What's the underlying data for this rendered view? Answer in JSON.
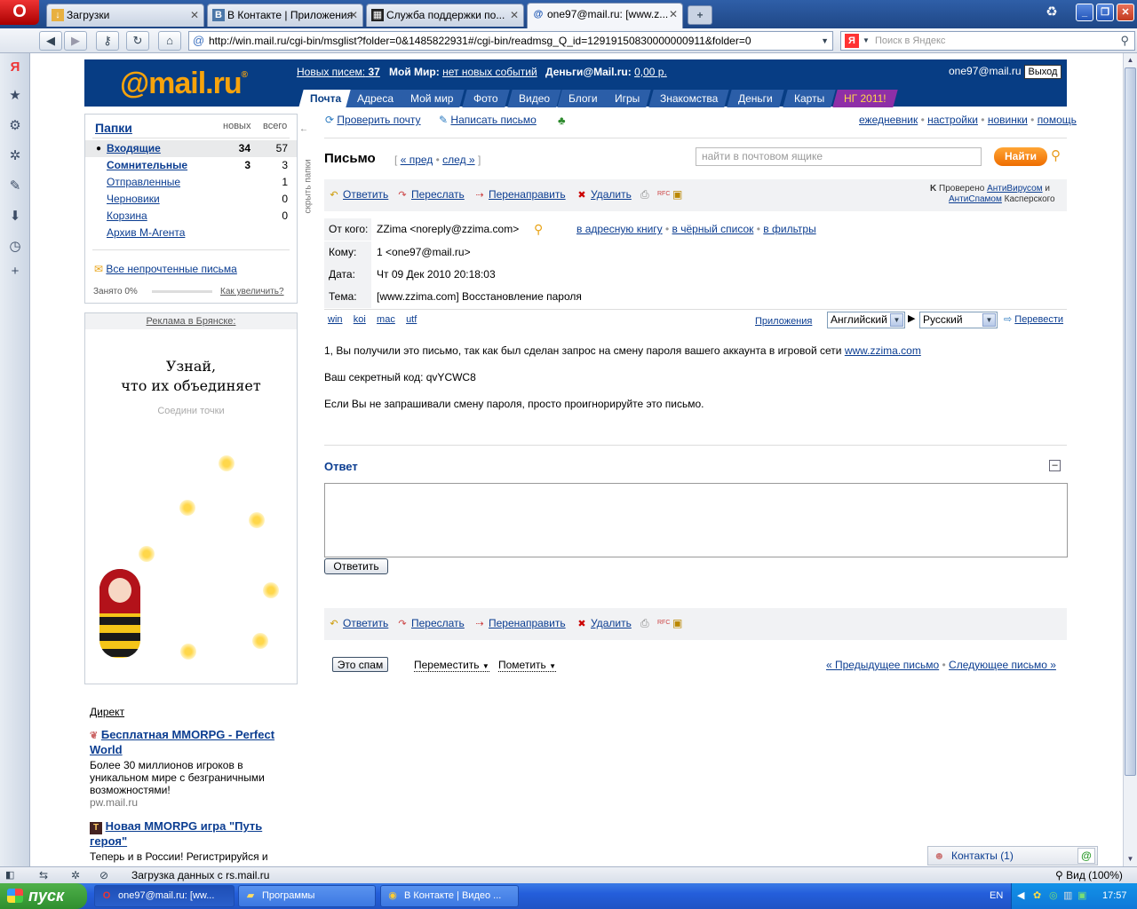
{
  "browser": {
    "tabs": [
      {
        "label": "Загрузки",
        "icon": "download-icon"
      },
      {
        "label": "В Контакте | Приложения",
        "icon": "vk-icon"
      },
      {
        "label": "Служба поддержки по...",
        "icon": "support-icon"
      },
      {
        "label": "one97@mail.ru: [www.z...",
        "icon": "mail-icon"
      }
    ],
    "url": "http://win.mail.ru/cgi-bin/msglist?folder=0&1485822931#/cgi-bin/readmsg_Q_id=12919150830000000911&folder=0",
    "search_placeholder": "Поиск в Яндекс",
    "yandex_letter": "Я",
    "status_text": "Загрузка данных с rs.mail.ru",
    "zoom": "Вид (100%)"
  },
  "header": {
    "logo": "@mail.ru",
    "new_mail_label": "Новых писем:",
    "new_mail_count": "37",
    "myworld_label": "Мой Мир:",
    "myworld_value": "нет новых событий",
    "money_label": "Деньги@Mail.ru:",
    "money_value": "0,00 р.",
    "user": "one97@mail.ru",
    "logout": "Выход",
    "nav": [
      "Почта",
      "Адреса",
      "Мой мир",
      "Фото",
      "Видео",
      "Блоги",
      "Игры",
      "Знакомства",
      "Деньги",
      "Карты",
      "НГ 2011!"
    ]
  },
  "folders": {
    "title": "Папки",
    "col_new": "новых",
    "col_all": "всего",
    "hide": "скрыть папки",
    "items": [
      {
        "name": "Входящие",
        "new": "34",
        "all": "57"
      },
      {
        "name": "Сомнительные",
        "new": "3",
        "all": "3"
      },
      {
        "name": "Отправленные",
        "new": "",
        "all": "1"
      },
      {
        "name": "Черновики",
        "new": "",
        "all": "0"
      },
      {
        "name": "Корзина",
        "new": "",
        "all": "0"
      },
      {
        "name": "Архив М-Агента",
        "new": "",
        "all": ""
      }
    ],
    "unread_link": "Все непрочтенные письма",
    "usage": "Занято 0%",
    "increase": "Как увеличить?"
  },
  "ad": {
    "header": "Реклама в Брянске:",
    "line1": "Узнай,",
    "line2": "что их объединяет",
    "sub": "Соедини точки"
  },
  "direct": {
    "title": "Директ",
    "items": [
      {
        "title": "Бесплатная MMORPG - Perfect World",
        "text": "Более 30 миллионов игроков в уникальном мире с безграничными возможностями!",
        "url": "pw.mail.ru"
      },
      {
        "title": "Новая MMORPG игра \"Путь героя\"",
        "text": "Теперь и в России! Регистрируйся и",
        "url": ""
      }
    ]
  },
  "actions": {
    "check": "Проверить почту",
    "compose": "Написать письмо",
    "right_links": [
      "ежедневник",
      "настройки",
      "новинки",
      "помощь"
    ]
  },
  "letter": {
    "title": "Письмо",
    "prev": "« пред",
    "next": "след »",
    "search_placeholder": "найти в почтовом ящике",
    "find": "Найти",
    "toolbar": {
      "reply": "Ответить",
      "forward": "Переслать",
      "redirect": "Перенаправить",
      "delete": "Удалить",
      "rfc": "RFC"
    },
    "checked_1": "Проверено",
    "checked_av": "АнтиВирусом",
    "checked_and": "и",
    "checked_as": "АнтиСпамом",
    "checked_2": "Касперского",
    "from_label": "От кого:",
    "from": "ZZima <noreply@zzima.com>",
    "from_links": [
      "в адресную книгу",
      "в чёрный список",
      "в фильтры"
    ],
    "to_label": "Кому:",
    "to": "1 <one97@mail.ru>",
    "date_label": "Дата:",
    "date": "Чт 09 Дек 2010 20:18:03",
    "subject_label": "Тема:",
    "subject": "[www.zzima.com] Восстановление пароля",
    "encodings": [
      "win",
      "koi",
      "mac",
      "utf"
    ],
    "apps": "Приложения",
    "lang_from": "Английский",
    "lang_to": "Русский",
    "translate": "Перевести",
    "body_1": "1, Вы получили это письмо, так как был сделан запрос на смену пароля вашего аккаунта в игровой сети",
    "body_link": "www.zzima.com",
    "body_2": "Ваш секретный код: qvYCWC8",
    "body_3": "Если Вы не запрашивали смену пароля, просто проигнорируйте это письмо."
  },
  "reply": {
    "title": "Ответ",
    "button": "Ответить"
  },
  "bottom": {
    "spam": "Это спам",
    "move": "Переместить",
    "mark": "Пометить",
    "prev": "« Предыдущее письмо",
    "next": "Следующее письмо »"
  },
  "contacts": {
    "label": "Контакты",
    "count": "(1)"
  },
  "taskbar": {
    "start": "пуск",
    "tasks": [
      "one97@mail.ru: [ww...",
      "Программы",
      "В Контакте | Видео ..."
    ],
    "lang": "EN",
    "time": "17:57"
  }
}
